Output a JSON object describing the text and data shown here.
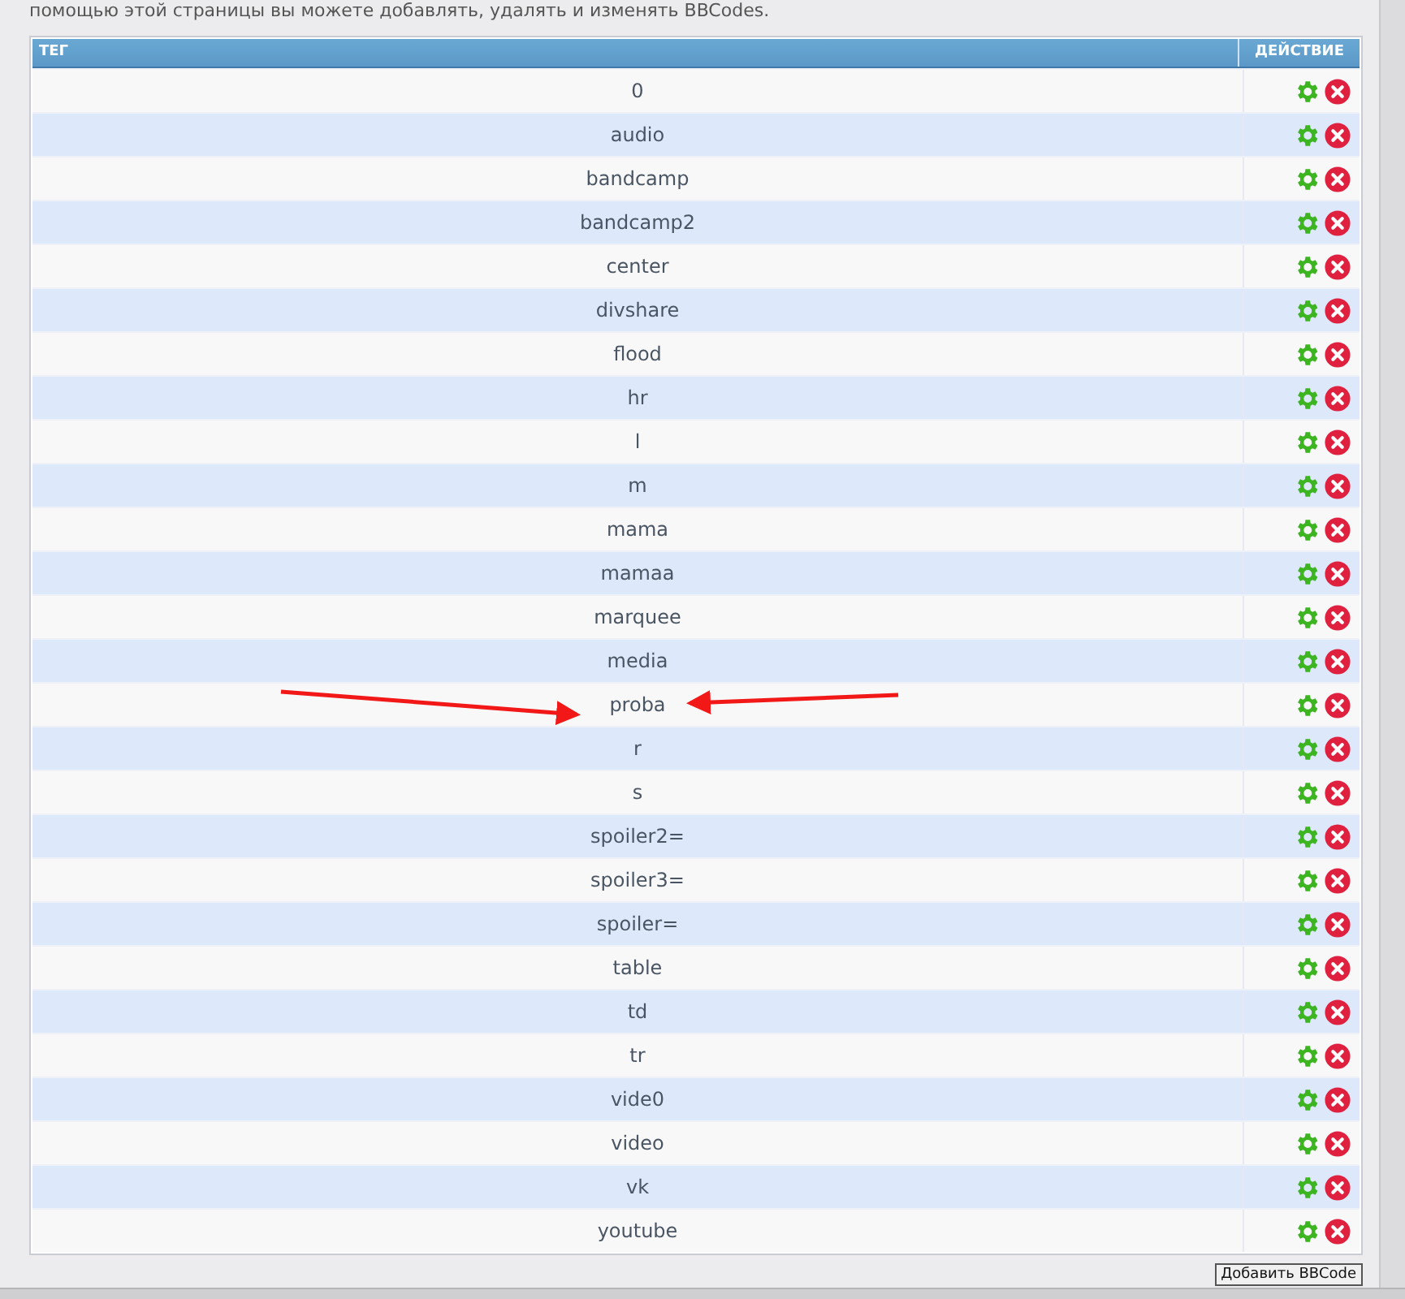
{
  "intro": "помощью этой страницы вы можете добавлять, удалять и изменять BBCodes.",
  "table": {
    "columns": [
      "ТЕГ",
      "ДЕЙСТВИЕ"
    ],
    "rows": [
      "0",
      "audio",
      "bandcamp",
      "bandcamp2",
      "center",
      "divshare",
      "flood",
      "hr",
      "l",
      "m",
      "mama",
      "mamaa",
      "marquee",
      "media",
      "proba",
      "r",
      "s",
      "spoiler2=",
      "spoiler3=",
      "spoiler=",
      "table",
      "td",
      "tr",
      "vide0",
      "video",
      "vk",
      "youtube"
    ]
  },
  "add_button": "Добавить BBCode"
}
